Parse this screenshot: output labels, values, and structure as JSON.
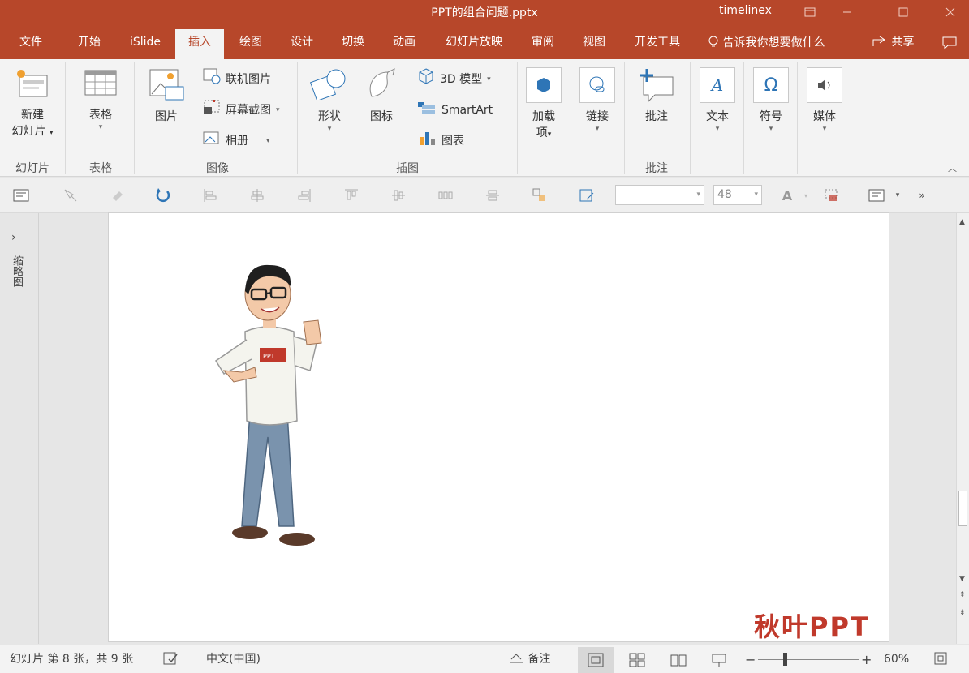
{
  "window": {
    "title": "PPT的组合问题.pptx",
    "user": "timelinex"
  },
  "tabs": [
    "文件",
    "开始",
    "iSlide",
    "插入",
    "绘图",
    "设计",
    "切换",
    "动画",
    "幻灯片放映",
    "审阅",
    "视图",
    "开发工具"
  ],
  "active_tab": "插入",
  "tell_me": "告诉我你想要做什么",
  "share_label": "共享",
  "ribbon": {
    "slides": {
      "new_slide": "新建",
      "new_slide_2": "幻灯片",
      "label": "幻灯片"
    },
    "tables": {
      "table": "表格",
      "label": "表格"
    },
    "images": {
      "picture": "图片",
      "online_picture": "联机图片",
      "screenshot": "屏幕截图",
      "album": "相册",
      "label": "图像"
    },
    "illustrations": {
      "shapes": "形状",
      "icons": "图标",
      "model_3d": "3D 模型",
      "smartart": "SmartArt",
      "chart": "图表",
      "label": "插图"
    },
    "addins": {
      "addins": "加载",
      "addins_2": "项"
    },
    "links": {
      "link": "链接"
    },
    "comments": {
      "comment": "批注",
      "label": "批注"
    },
    "text": {
      "text": "文本"
    },
    "symbols": {
      "symbol": "符号"
    },
    "media": {
      "media": "媒体"
    }
  },
  "toolbar": {
    "font_name": "",
    "font_size": "48"
  },
  "rail": {
    "label": "缩略图"
  },
  "slide": {
    "brand": "秋叶PPT"
  },
  "status": {
    "slide_info": "幻灯片 第 8 张，共 9 张",
    "language": "中文(中国)",
    "notes": "备注",
    "zoom": "60%"
  },
  "colors": {
    "accent": "#b7472a",
    "brand": "#c0392b"
  }
}
